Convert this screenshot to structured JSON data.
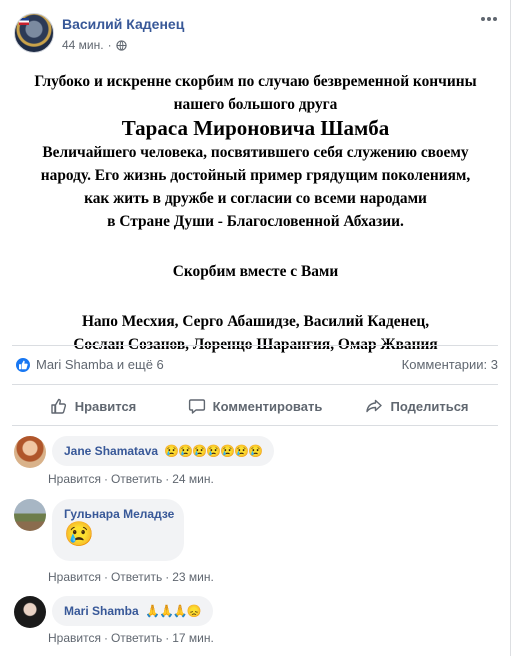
{
  "post": {
    "author": "Василий Каденец",
    "time": "44 мин.",
    "privacy_icon": "globe-icon",
    "lines": [
      "Глубоко и искренне скорбим по случаю безвременной кончины",
      "нашего большого друга",
      "Тараса Мироновича Шамба",
      "Величайшего человека, посвятившего себя служению своему",
      "народу. Его жизнь достойный пример грядущим поколениям,",
      "как жить в дружбе и согласии со всеми народами",
      "в Стране  Души - Благословенной Абхазии.",
      "Скорбим вместе с Вами",
      "Напо Месхия, Серго Абашидзе, Василий Каденец,",
      "Сослан Созанов, Лоренцо Шарангия, Омар Жвания"
    ]
  },
  "reactions": {
    "text": "Mari Shamba и ещё 6",
    "comments": "Комментарии: 3"
  },
  "actions": {
    "like": "Нравится",
    "comment": "Комментировать",
    "share": "Поделиться"
  },
  "comments": [
    {
      "name": "Jane Shamatava",
      "text": "😢😢😢😢😢😢😢",
      "like": "Нравится",
      "reply": "Ответить",
      "time": "24 мин."
    },
    {
      "name": "Гульнара Меладзе",
      "text": "😢",
      "like": "Нравится",
      "reply": "Ответить",
      "time": "23 мин."
    },
    {
      "name": "Mari Shamba",
      "text": "🙏🙏🙏😞",
      "like": "Нравится",
      "reply": "Ответить",
      "time": "17 мин."
    }
  ],
  "colors": {
    "link": "#385898",
    "facebook_blue": "#1877f2",
    "muted": "#606770",
    "bubble": "#f2f3f5"
  }
}
